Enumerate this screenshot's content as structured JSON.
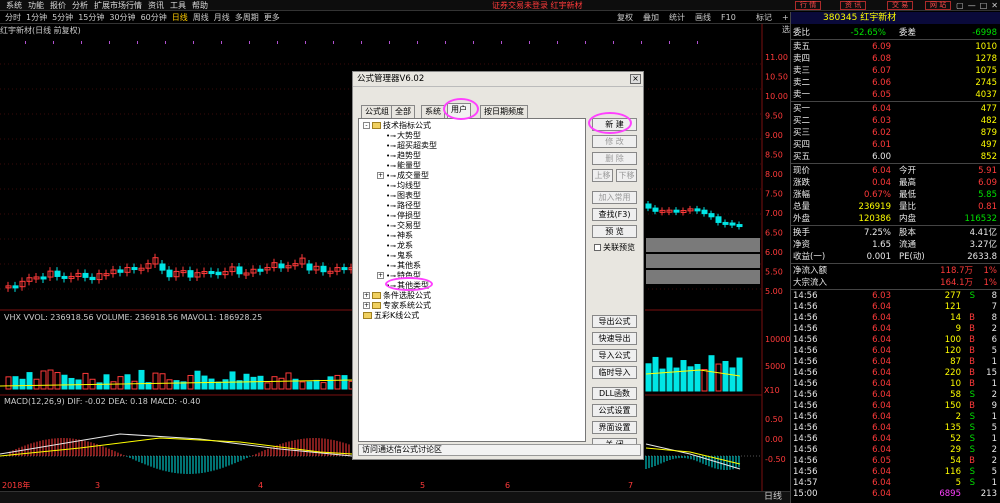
{
  "menubar": {
    "items": [
      "系统",
      "功能",
      "报价",
      "分析",
      "扩展市场行情",
      "资讯",
      "工具",
      "帮助"
    ],
    "center": "证券交易未登录 红宇新材",
    "right_buttons": [
      "行 情",
      "资 讯",
      "交 易",
      "网 站"
    ]
  },
  "toolbar": {
    "periods": [
      "分时",
      "1分钟",
      "5分钟",
      "15分钟",
      "30分钟",
      "60分钟",
      "日线",
      "周线",
      "月线",
      "多周期",
      "更多"
    ],
    "active": "日线",
    "right": [
      "复权",
      "叠加",
      "统计",
      "画线",
      "F10",
      "标记",
      "+自选",
      "返回"
    ]
  },
  "chart": {
    "title": "红宇新材(日线 前复权)",
    "vol_label": "VHX VVOL: 236918.56  VOLUME: 236918.56  MAVOL1: 186928.25",
    "macd_label": "MACD(12,26,9) DIF: -0.02  DEA: 0.18  MACD: -0.40",
    "price_ticks": [
      "11.00",
      "10.50",
      "10.00",
      "9.50",
      "9.00",
      "8.50",
      "8.00",
      "7.50",
      "7.00",
      "6.50",
      "6.00",
      "5.50",
      "5.00"
    ],
    "vol_ticks": [
      "10000",
      "5000"
    ],
    "vol_unit": "X10",
    "macd_ticks": [
      "0.50",
      "0.00",
      "-0.50"
    ],
    "x_labels": [
      "2018年",
      "3",
      "4",
      "5",
      "6",
      "7"
    ],
    "status_right": "日线"
  },
  "dialog": {
    "title": "公式管理器V6.02",
    "tabs": [
      "公式组",
      "全部",
      "系统",
      "用户",
      "按日期频度"
    ],
    "active_tab": "用户",
    "tree": [
      {
        "label": "技术指标公式",
        "level": 0,
        "type": "folder",
        "expander": "-"
      },
      {
        "label": "大势型",
        "level": 1,
        "type": "fx"
      },
      {
        "label": "超买超卖型",
        "level": 1,
        "type": "fx"
      },
      {
        "label": "趋势型",
        "level": 1,
        "type": "fx"
      },
      {
        "label": "能量型",
        "level": 1,
        "type": "fx"
      },
      {
        "label": "成交量型",
        "level": 1,
        "type": "fx",
        "expander": "+"
      },
      {
        "label": "均线型",
        "level": 1,
        "type": "fx"
      },
      {
        "label": "图表型",
        "level": 1,
        "type": "fx"
      },
      {
        "label": "路径型",
        "level": 1,
        "type": "fx"
      },
      {
        "label": "停损型",
        "level": 1,
        "type": "fx"
      },
      {
        "label": "交易型",
        "level": 1,
        "type": "fx"
      },
      {
        "label": "神系",
        "level": 1,
        "type": "fx"
      },
      {
        "label": "龙系",
        "level": 1,
        "type": "fx"
      },
      {
        "label": "鬼系",
        "level": 1,
        "type": "fx"
      },
      {
        "label": "其他系",
        "level": 1,
        "type": "fx"
      },
      {
        "label": "特色型",
        "level": 1,
        "type": "fx",
        "expander": "+"
      },
      {
        "label": "其他类型",
        "level": 1,
        "type": "fx",
        "selected": true
      },
      {
        "label": "条件选股公式",
        "level": 0,
        "type": "folder",
        "expander": "+"
      },
      {
        "label": "专家系统公式",
        "level": 0,
        "type": "folder",
        "expander": "+"
      },
      {
        "label": "五彩K线公式",
        "level": 0,
        "type": "folder"
      }
    ],
    "buttons_top": [
      "新 建",
      "修 改",
      "删 除"
    ],
    "btn_up": "上移",
    "btn_down": "下移",
    "buttons_mid": [
      "加入常用",
      "查找(F3)",
      "预 览"
    ],
    "checkbox": "关联预览",
    "buttons_bottom": [
      "导出公式",
      "快速导出",
      "导入公式",
      "临时导入",
      "DLL函数",
      "公式设置",
      "界面设置",
      "关 闭"
    ],
    "status": "访问通达信公式讨论区"
  },
  "quote": {
    "code_name": "380345 红宇新材",
    "weibi": {
      "label": "委比",
      "value": "-52.65%",
      "label2": "委差",
      "value2": "-6998"
    },
    "asks": [
      {
        "label": "卖五",
        "price": "6.09",
        "vol": "1010"
      },
      {
        "label": "卖四",
        "price": "6.08",
        "vol": "1278"
      },
      {
        "label": "卖三",
        "price": "6.07",
        "vol": "1075"
      },
      {
        "label": "卖二",
        "price": "6.06",
        "vol": "2745"
      },
      {
        "label": "卖一",
        "price": "6.05",
        "vol": "4037"
      }
    ],
    "bids": [
      {
        "label": "买一",
        "price": "6.04",
        "vol": "477"
      },
      {
        "label": "买二",
        "price": "6.03",
        "vol": "482"
      },
      {
        "label": "买三",
        "price": "6.02",
        "vol": "879"
      },
      {
        "label": "买四",
        "price": "6.01",
        "vol": "497"
      },
      {
        "label": "买五",
        "price": "6.00",
        "vol": "852"
      }
    ],
    "stats": [
      {
        "l1": "现价",
        "v1": "6.04",
        "l2": "今开",
        "v2": "5.91"
      },
      {
        "l1": "涨跌",
        "v1": "0.04",
        "l2": "最高",
        "v2": "6.09"
      },
      {
        "l1": "涨幅",
        "v1": "0.67%",
        "l2": "最低",
        "v2": "5.85"
      },
      {
        "l1": "总量",
        "v1": "236919",
        "l2": "量比",
        "v2": "0.81"
      },
      {
        "l1": "外盘",
        "v1": "120386",
        "l2": "内盘",
        "v2": "116532"
      }
    ],
    "stats2": [
      {
        "l1": "换手",
        "v1": "7.25%",
        "l2": "股本",
        "v2": "4.41亿"
      },
      {
        "l1": "净资",
        "v1": "1.65",
        "l2": "流通",
        "v2": "3.27亿"
      },
      {
        "l1": "收益(一)",
        "v1": "0.001",
        "l2": "PE(动)",
        "v2": "2633.8"
      }
    ],
    "flows": [
      {
        "label": "净流入额",
        "value": "118.7万",
        "pct": "1%"
      },
      {
        "label": "大宗流入",
        "value": "164.1万",
        "pct": "1%"
      }
    ],
    "ticks": [
      {
        "t": "14:56",
        "p": "6.03",
        "v": "277",
        "s": "S",
        "n": "8"
      },
      {
        "t": "14:56",
        "p": "6.04",
        "v": "121",
        "s": "",
        "n": "7"
      },
      {
        "t": "14:56",
        "p": "6.04",
        "v": "14",
        "s": "B",
        "n": "8"
      },
      {
        "t": "14:56",
        "p": "6.04",
        "v": "9",
        "s": "B",
        "n": "2"
      },
      {
        "t": "14:56",
        "p": "6.04",
        "v": "100",
        "s": "B",
        "n": "6"
      },
      {
        "t": "14:56",
        "p": "6.04",
        "v": "120",
        "s": "B",
        "n": "5"
      },
      {
        "t": "14:56",
        "p": "6.04",
        "v": "87",
        "s": "B",
        "n": "1"
      },
      {
        "t": "14:56",
        "p": "6.04",
        "v": "220",
        "s": "B",
        "n": "15"
      },
      {
        "t": "14:56",
        "p": "6.04",
        "v": "10",
        "s": "B",
        "n": "1"
      },
      {
        "t": "14:56",
        "p": "6.04",
        "v": "58",
        "s": "S",
        "n": "2"
      },
      {
        "t": "14:56",
        "p": "6.04",
        "v": "150",
        "s": "B",
        "n": "9"
      },
      {
        "t": "14:56",
        "p": "6.04",
        "v": "2",
        "s": "S",
        "n": "1"
      },
      {
        "t": "14:56",
        "p": "6.04",
        "v": "135",
        "s": "S",
        "n": "5"
      },
      {
        "t": "14:56",
        "p": "6.04",
        "v": "52",
        "s": "S",
        "n": "1"
      },
      {
        "t": "14:56",
        "p": "6.04",
        "v": "29",
        "s": "S",
        "n": "2"
      },
      {
        "t": "14:56",
        "p": "6.05",
        "v": "54",
        "s": "B",
        "n": "2"
      },
      {
        "t": "14:56",
        "p": "6.04",
        "v": "116",
        "s": "S",
        "n": "5"
      },
      {
        "t": "14:57",
        "p": "6.04",
        "v": "5",
        "s": "S",
        "n": "1"
      },
      {
        "t": "15:00",
        "p": "6.04",
        "v": "6895",
        "s": "",
        "n": "213"
      }
    ]
  },
  "colors": {
    "up": "#ff3a3a",
    "down": "#00e5e5",
    "ring": "#ff40ff",
    "dialog_bg": "#e8e6e0"
  }
}
